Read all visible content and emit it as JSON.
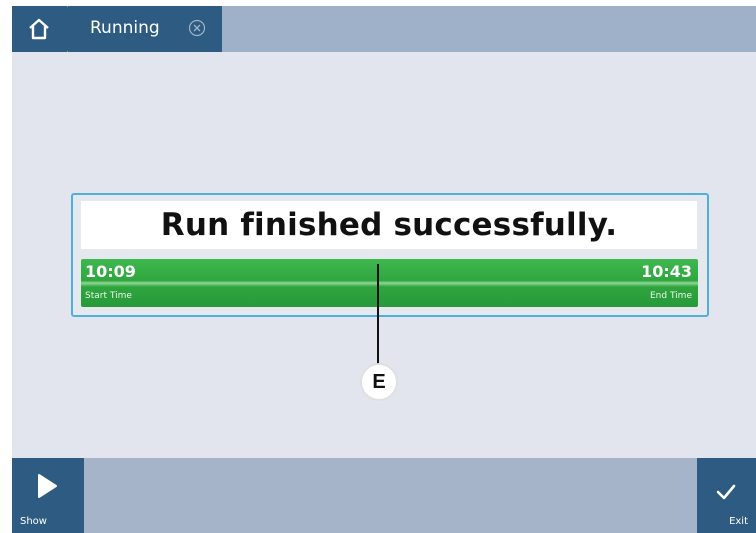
{
  "breadcrumb": {
    "home_icon": "home-icon",
    "current_tab": "Running",
    "close_icon": "close-circle-icon"
  },
  "status": {
    "message": "Run finished successfully.",
    "start_time": "10:09",
    "start_label": "Start Time",
    "end_time": "10:43",
    "end_label": "End Time",
    "progress_fraction": 1.0,
    "progress_color": "#2fa53e"
  },
  "callout": {
    "label": "E"
  },
  "footer": {
    "show_label": "Show",
    "show_icon": "play-icon",
    "exit_label": "Exit",
    "exit_icon": "checkmark-icon"
  },
  "colors": {
    "accent": "#2d5b82",
    "panel_border": "#4fb0dc",
    "background": "#e2e4ee"
  }
}
